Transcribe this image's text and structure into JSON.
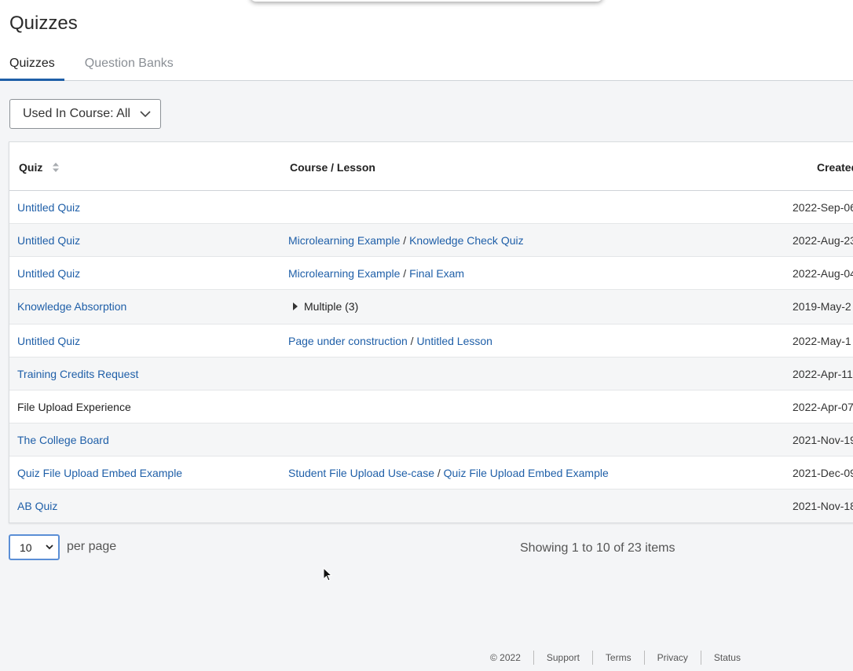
{
  "page": {
    "title": "Quizzes"
  },
  "tabs": [
    {
      "label": "Quizzes",
      "active": true
    },
    {
      "label": "Question Banks",
      "active": false
    }
  ],
  "filter": {
    "label": "Used In Course: All",
    "icon": "chevron-down-icon"
  },
  "table": {
    "columns": [
      "Quiz",
      "Course / Lesson",
      "Created"
    ],
    "rows": [
      {
        "quiz": "Untitled Quiz",
        "course": "",
        "lesson": "",
        "created": "2022-Sep-06"
      },
      {
        "quiz": "Untitled Quiz",
        "course": "Microlearning Example",
        "lesson": "Knowledge Check Quiz",
        "created": "2022-Aug-23"
      },
      {
        "quiz": "Untitled Quiz",
        "course": "Microlearning Example",
        "lesson": "Final Exam",
        "created": "2022-Aug-04"
      },
      {
        "quiz": "Knowledge Absorption",
        "multiple": "Multiple (3)",
        "created": "2019-May-2"
      },
      {
        "quiz": "Untitled Quiz",
        "course": "Page under construction",
        "lesson": "Untitled Lesson",
        "created": "2022-May-1"
      },
      {
        "quiz": "Training Credits Request",
        "course": "",
        "lesson": "",
        "created": "2022-Apr-11"
      },
      {
        "quiz": "File Upload Experience",
        "course": "",
        "lesson": "",
        "created": "2022-Apr-07"
      },
      {
        "quiz": "The College Board",
        "course": "",
        "lesson": "",
        "created": "2021-Nov-19"
      },
      {
        "quiz": "Quiz File Upload Embed Example",
        "course": "Student File Upload Use-case",
        "lesson": "Quiz File Upload Embed Example",
        "created": "2021-Dec-09"
      },
      {
        "quiz": "AB Quiz",
        "course": "",
        "lesson": "",
        "created": "2021-Nov-18"
      }
    ]
  },
  "pagination": {
    "per_page_value": "10",
    "per_page_label": "per page",
    "summary": "Showing 1 to 10 of 23 items"
  },
  "footer": {
    "copyright": "© 2022",
    "links": [
      "Support",
      "Terms",
      "Privacy",
      "Status"
    ]
  },
  "colors": {
    "link": "#1f5fa8",
    "tab_active_underline": "#1f5fa8"
  }
}
